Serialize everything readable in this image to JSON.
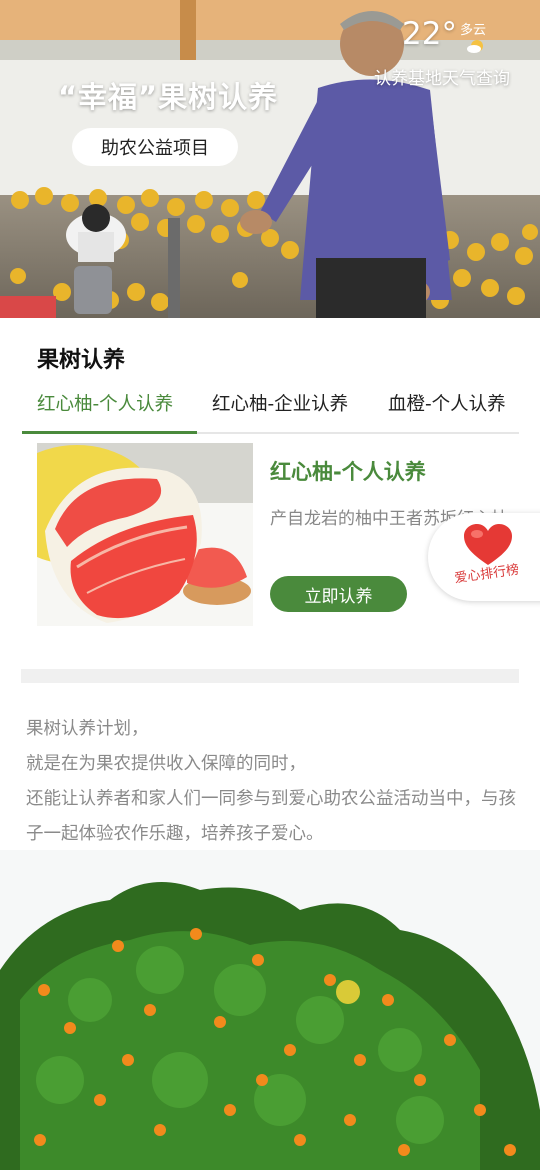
{
  "hero": {
    "title": "“幸福”果树认养",
    "pill": "助农公益项目",
    "weather": {
      "temp": "22°",
      "condition": "多云",
      "link": "认养基地天气查询"
    }
  },
  "section": {
    "title": "果树认养",
    "tabs": [
      {
        "label": "红心柚-个人认养"
      },
      {
        "label": "红心柚-企业认养"
      },
      {
        "label": "血橙-个人认养"
      }
    ]
  },
  "product": {
    "name": "红心柚-个人认养",
    "desc": "产自龙岩的柚中王者苏坂红心柚",
    "button": "立即认养"
  },
  "badge": {
    "label": "爱心排行榜"
  },
  "intro": {
    "lines": [
      "果树认养计划，",
      "就是在为果农提供收入保障的同时，",
      "还能让认养者和家人们一同参与到爱心助农公益活动当中，与孩子一起体验农作乐趣，培养孩子爱心。"
    ]
  },
  "colors": {
    "accent": "#4a8a3c",
    "heart": "#e53935",
    "muted_text": "#888888"
  }
}
